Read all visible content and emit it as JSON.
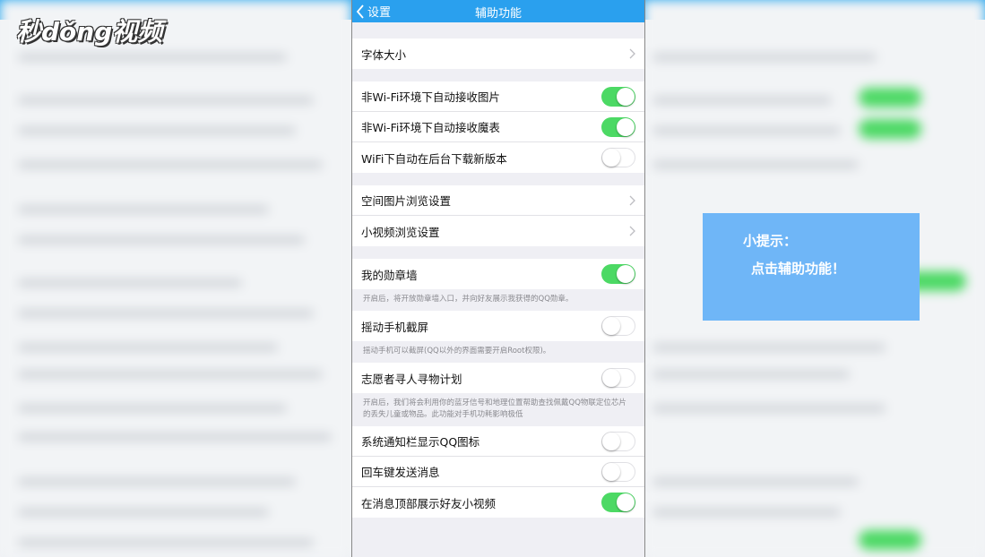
{
  "watermark": "秒dǒng视频",
  "nav": {
    "back_label": "设置",
    "title": "辅助功能"
  },
  "colors": {
    "nav_bg": "#2aa0ee",
    "toggle_on": "#4cd964",
    "tip_bg": "#6fb6f7"
  },
  "rows": {
    "font_size": "字体大小",
    "nonwifi_images": "非Wi-Fi环境下自动接收图片",
    "nonwifi_magic": "非Wi-Fi环境下自动接收魔表",
    "wifi_download": "WiFi下自动在后台下载新版本",
    "space_photo": "空间图片浏览设置",
    "short_video": "小视频浏览设置",
    "medal_wall": "我的勋章墙",
    "medal_note": "开启后，将开放勋章墙入口，并向好友展示我获得的QQ勋章。",
    "shake_screenshot": "摇动手机截屏",
    "shake_note": "摇动手机可以截屏(QQ以外的界面需要开启Root权限)。",
    "volunteer": "志愿者寻人寻物计划",
    "volunteer_note": "开启后，我们将会利用你的蓝牙信号和地理位置帮助查找佩戴QQ物联定位芯片的丢失儿童或物品。此功能对手机功耗影响极低",
    "notif_icon": "系统通知栏显示QQ图标",
    "enter_send": "回车键发送消息",
    "friend_video": "在消息顶部展示好友小视频"
  },
  "toggles": {
    "nonwifi_images": true,
    "nonwifi_magic": true,
    "wifi_download": false,
    "medal_wall": true,
    "shake_screenshot": false,
    "volunteer": false,
    "notif_icon": false,
    "enter_send": false,
    "friend_video": true
  },
  "tip": {
    "title": "小提示：",
    "text": "点击辅助功能！"
  }
}
